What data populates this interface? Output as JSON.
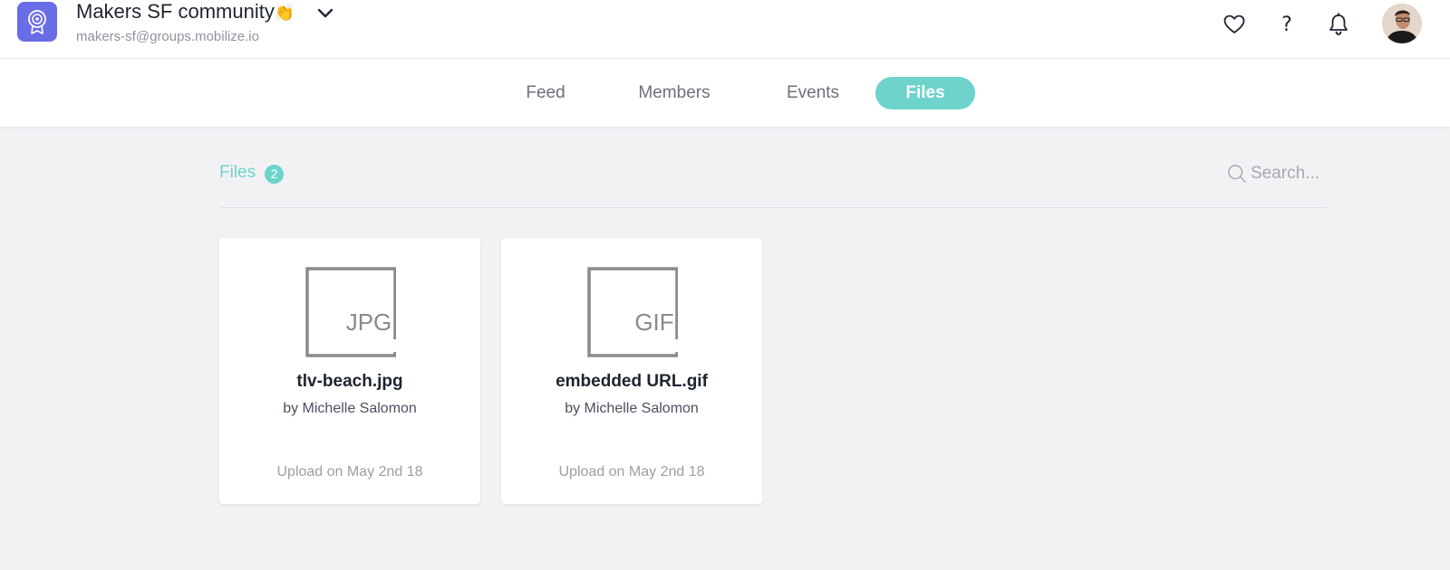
{
  "group": {
    "title": "Makers SF community",
    "emoji": "👏",
    "email": "makers-sf@groups.mobilize.io"
  },
  "icons": {
    "logo": "badge-icon",
    "dropdown": "chevron-down-icon",
    "favorites": "heart-icon",
    "help": "?",
    "notifications": "bell-icon",
    "search": "search-icon"
  },
  "nav": {
    "tabs": [
      {
        "label": "Feed"
      },
      {
        "label": "Members"
      },
      {
        "label": "Events"
      },
      {
        "label": "Files",
        "active": true
      }
    ]
  },
  "files_section": {
    "label": "Files",
    "count": "2",
    "search_placeholder": "Search..."
  },
  "files": [
    {
      "type_label": "JPG",
      "name": "tlv-beach.jpg",
      "author": "by Michelle Salomon",
      "date": "Upload on May 2nd 18"
    },
    {
      "type_label": "GIF",
      "name": "embedded URL.gif",
      "author": "by Michelle Salomon",
      "date": "Upload on May 2nd 18"
    }
  ],
  "colors": {
    "accent": "#6dd3cb",
    "logo_bg": "#6a6ce8",
    "text_dark": "#1f2430",
    "text_muted": "#8e939c"
  }
}
